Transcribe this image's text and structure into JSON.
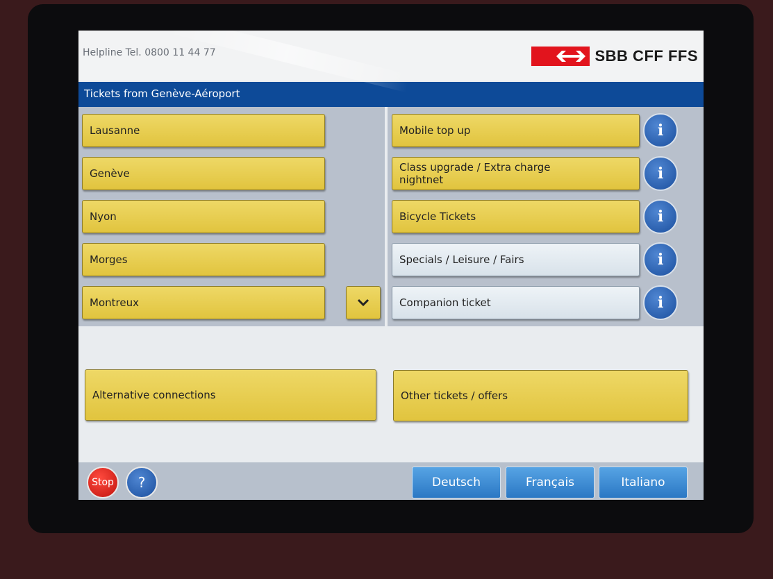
{
  "header": {
    "helpline": "Helpline Tel. 0800 11 44 77",
    "brand": "SBB CFF FFS"
  },
  "title": "Tickets from Genève-Aéroport",
  "destinations": [
    "Lausanne",
    "Genève",
    "Nyon",
    "Morges",
    "Montreux"
  ],
  "options": [
    "Mobile top up",
    "Class upgrade / Extra charge nightnet",
    "Bicycle Tickets",
    "Specials / Leisure / Fairs",
    "Companion ticket"
  ],
  "info_label": "i",
  "actions": {
    "alternative": "Alternative connections",
    "other": "Other tickets / offers"
  },
  "footer": {
    "stop": "Stop",
    "help": "?",
    "languages": [
      "Deutsch",
      "Français",
      "Italiano"
    ]
  },
  "colors": {
    "brand_red": "#e2141d",
    "title_blue": "#0d4a98",
    "button_yellow": "#e6cc4a"
  }
}
